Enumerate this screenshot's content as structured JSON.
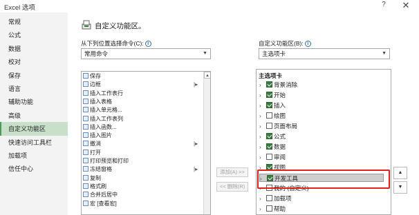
{
  "window": {
    "title": "Excel 选项",
    "help_glyph": "?",
    "close_glyph": "✕"
  },
  "nav": {
    "items": [
      "常规",
      "公式",
      "数据",
      "校对",
      "保存",
      "语言",
      "辅助功能",
      "高级",
      "自定义功能区",
      "快速访问工具栏",
      "加载项",
      "信任中心"
    ],
    "active_index": 8
  },
  "main": {
    "header": "自定义功能区。",
    "left_label": "从下列位置选择命令(C):",
    "left_select": "常用命令",
    "right_label": "自定义功能区(B):",
    "right_select": "主选项卡",
    "add_button": "添加(A) >>",
    "remove_button": "<< 删除(R)"
  },
  "commands": [
    {
      "label": "保存",
      "submenu": false
    },
    {
      "label": "边框",
      "submenu": true
    },
    {
      "label": "插入工作表行",
      "submenu": false
    },
    {
      "label": "插入表格",
      "submenu": false
    },
    {
      "label": "插入单元格...",
      "submenu": false
    },
    {
      "label": "插入工作表列",
      "submenu": false
    },
    {
      "label": "插入函数...",
      "submenu": false
    },
    {
      "label": "插入图片",
      "submenu": false
    },
    {
      "label": "撤消",
      "submenu": true
    },
    {
      "label": "打开",
      "submenu": false
    },
    {
      "label": "打印预览和打印",
      "submenu": false
    },
    {
      "label": "冻结窗格",
      "submenu": true
    },
    {
      "label": "复制",
      "submenu": false
    },
    {
      "label": "格式刷",
      "submenu": false
    },
    {
      "label": "合并后居中",
      "submenu": false
    },
    {
      "label": "宏 [查看宏]",
      "submenu": false
    }
  ],
  "tree": {
    "heading": "主选项卡",
    "items": [
      {
        "label": "背景消除",
        "checked": true
      },
      {
        "label": "开始",
        "checked": true
      },
      {
        "label": "插入",
        "checked": true
      },
      {
        "label": "绘图",
        "checked": false
      },
      {
        "label": "页面布局",
        "checked": false
      },
      {
        "label": "公式",
        "checked": true
      },
      {
        "label": "数据",
        "checked": true
      },
      {
        "label": "审阅",
        "checked": false
      },
      {
        "label": "视图",
        "checked": true
      },
      {
        "label": "开发工具",
        "checked": true,
        "selected": true
      },
      {
        "label": "我的 (自定义)",
        "checked": false
      },
      {
        "label": "加载项",
        "checked": false
      },
      {
        "label": "帮助",
        "checked": false
      }
    ]
  },
  "colors": {
    "highlight_box": "#e0201a",
    "nav_active": "#c8dfc9",
    "checkbox_on": "#3a7d3e"
  }
}
